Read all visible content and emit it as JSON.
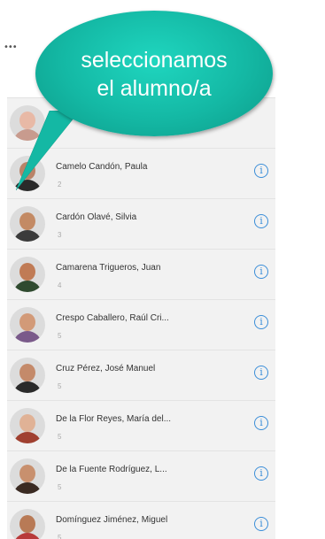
{
  "status": {
    "dots": "•••"
  },
  "callout": {
    "line1": "seleccionamos",
    "line2": "el alumno/a",
    "color": "#14b8a4"
  },
  "students": [
    {
      "name": "",
      "number": "",
      "skin": "#e8b9a6",
      "shirt": "#c89b8e"
    },
    {
      "name": "Camelo Candón, Paula",
      "number": "2",
      "skin": "#b98368",
      "shirt": "#2a2a2a"
    },
    {
      "name": "Cardón Olavé, Silvia",
      "number": "3",
      "skin": "#c38a64",
      "shirt": "#3b3b3b"
    },
    {
      "name": "Camarena Trigueros, Juan",
      "number": "4",
      "skin": "#c07b55",
      "shirt": "#2f4a2f"
    },
    {
      "name": "Crespo Caballero, Raúl Cri...",
      "number": "5",
      "skin": "#d29a78",
      "shirt": "#7a5a8a"
    },
    {
      "name": "Cruz Pérez, José Manuel",
      "number": "5",
      "skin": "#c48a6a",
      "shirt": "#2a2a2a"
    },
    {
      "name": "De la Flor Reyes, María del...",
      "number": "5",
      "skin": "#e0b296",
      "shirt": "#a04030"
    },
    {
      "name": "De la Fuente Rodríguez, L...",
      "number": "5",
      "skin": "#c8906e",
      "shirt": "#3a2a22"
    },
    {
      "name": "Domínguez Jiménez, Miguel",
      "number": "5",
      "skin": "#b87a56",
      "shirt": "#b83a3a"
    }
  ],
  "info_icon_color": "#3b8ed8"
}
